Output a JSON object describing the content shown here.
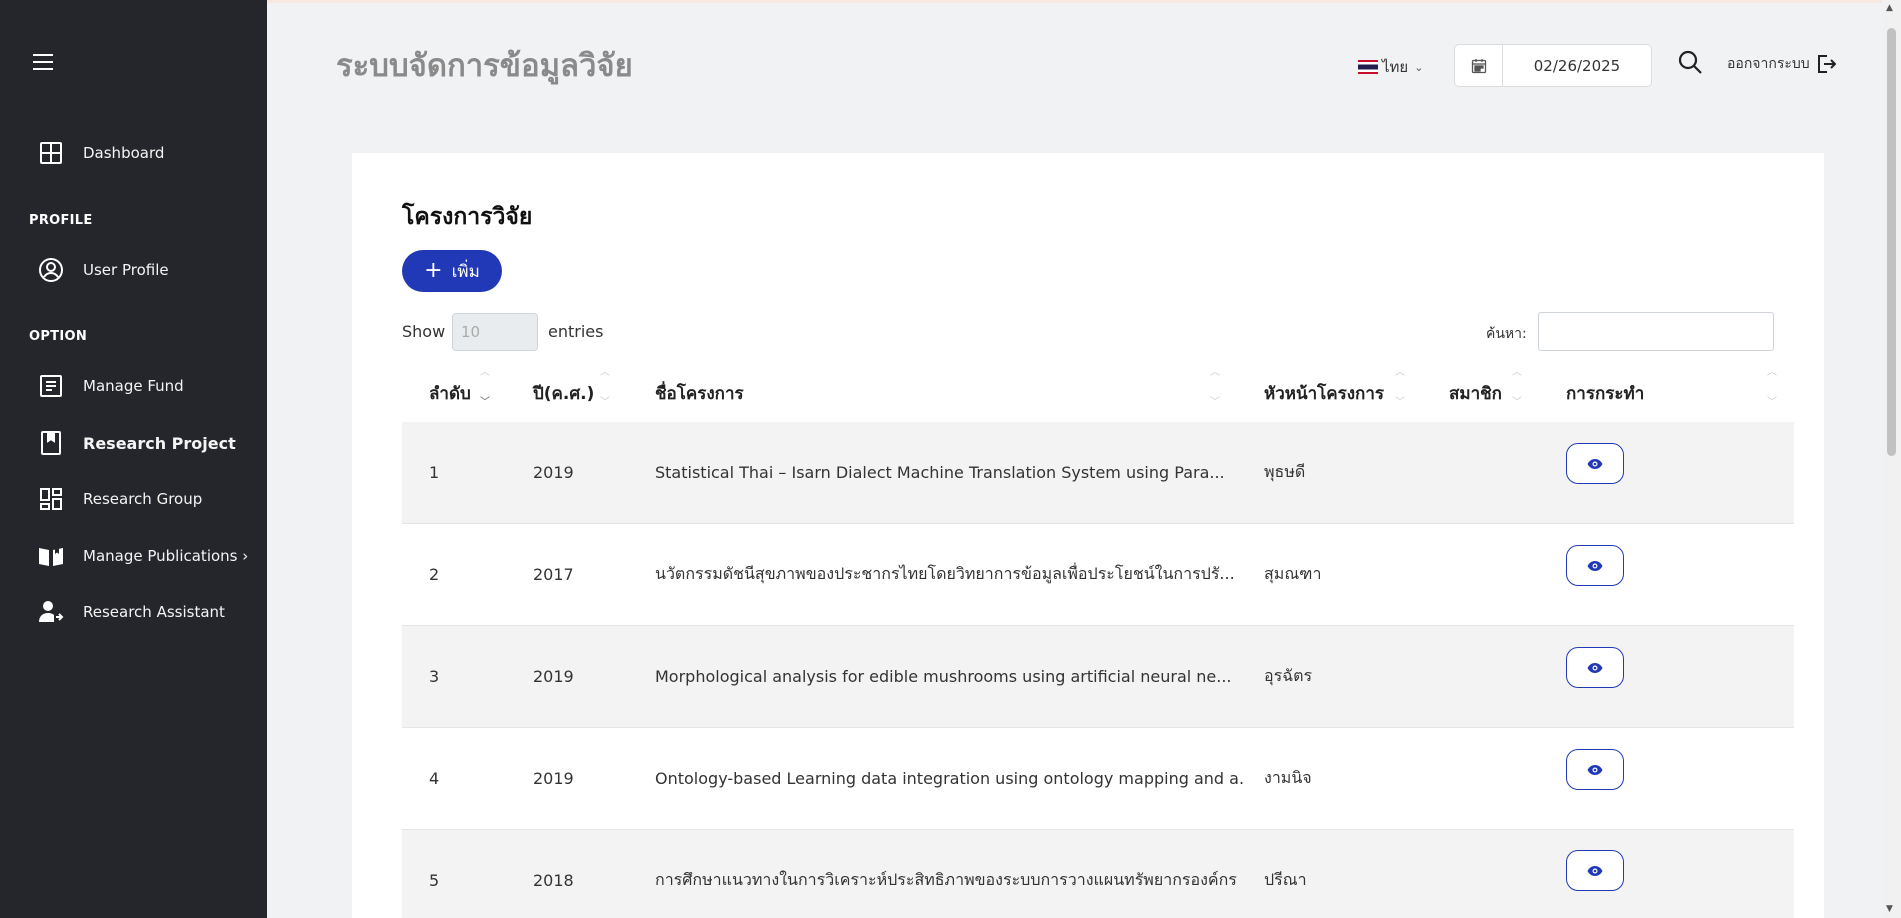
{
  "app": {
    "title": "ระบบจัดการข้อมูลวิจัย"
  },
  "header": {
    "language": "ไทย",
    "date": "02/26/2025",
    "logout_label": "ออกจากระบบ"
  },
  "sidebar": {
    "items_top": [
      {
        "label": "Dashboard",
        "icon": "dashboard-icon"
      }
    ],
    "profile_header": "PROFILE",
    "profile_items": [
      {
        "label": "User Profile",
        "icon": "user-circle-icon"
      }
    ],
    "option_header": "OPTION",
    "option_items": [
      {
        "label": "Manage Fund",
        "icon": "document-icon"
      },
      {
        "label": "Research Project",
        "icon": "bookmark-book-icon",
        "active": true
      },
      {
        "label": "Research Group",
        "icon": "grid-layout-icon"
      },
      {
        "label": "Manage Publications ›",
        "icon": "open-book-icon"
      },
      {
        "label": "Research Assistant",
        "icon": "user-plus-icon"
      }
    ]
  },
  "page": {
    "card_title": "โครงการวิจัย",
    "add_button": "เพิ่ม",
    "show_label": "Show",
    "entries_value": "10",
    "entries_label": "entries",
    "search_label": "ค้นหา:",
    "search_value": ""
  },
  "table": {
    "columns": [
      "ลำดับ",
      "ปี(ค.ศ.)",
      "ชื่อโครงการ",
      "หัวหน้าโครงการ",
      "สมาชิก",
      "การกระทำ"
    ],
    "rows": [
      {
        "no": "1",
        "year": "2019",
        "name": "Statistical Thai – Isarn Dialect Machine Translation System using Para...",
        "lead": "พุธษดี",
        "members": ""
      },
      {
        "no": "2",
        "year": "2017",
        "name": "นวัตกรรมดัชนีสุขภาพของประชากรไทยโดยวิทยาการข้อมูลเพื่อประโยชน์ในการปรั...",
        "lead": "สุมณฑา",
        "members": ""
      },
      {
        "no": "3",
        "year": "2019",
        "name": "Morphological analysis for edible mushrooms using artificial neural ne...",
        "lead": "อุรฉัตร",
        "members": ""
      },
      {
        "no": "4",
        "year": "2019",
        "name": "Ontology-based Learning data integration using ontology mapping and a...",
        "lead": "งามนิจ",
        "members": ""
      },
      {
        "no": "5",
        "year": "2018",
        "name": "การศึกษาแนวทางในการวิเคราะห์ประสิทธิภาพของระบบการวางแผนทรัพยากรองค์กร",
        "lead": "ปรีณา",
        "members": ""
      }
    ]
  },
  "colors": {
    "sidebar_bg": "#25262c",
    "accent": "#2139b6",
    "page_bg": "#f1f2f4"
  }
}
